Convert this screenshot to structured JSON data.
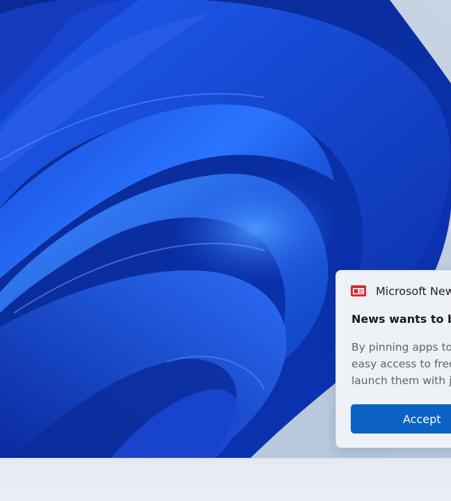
{
  "desktop": {
    "wallpaper": "windows-11-bloom",
    "accent_color": "#0b62c4"
  },
  "notification": {
    "app_icon": "microsoft-news-icon",
    "app_name": "Microsoft New",
    "title": "News wants to be",
    "body_lines": [
      "By pinning apps to",
      "easy access to frec",
      "launch them with j"
    ],
    "accept_label": "Accept"
  },
  "taskbar": {
    "background": "#e8edf3"
  }
}
